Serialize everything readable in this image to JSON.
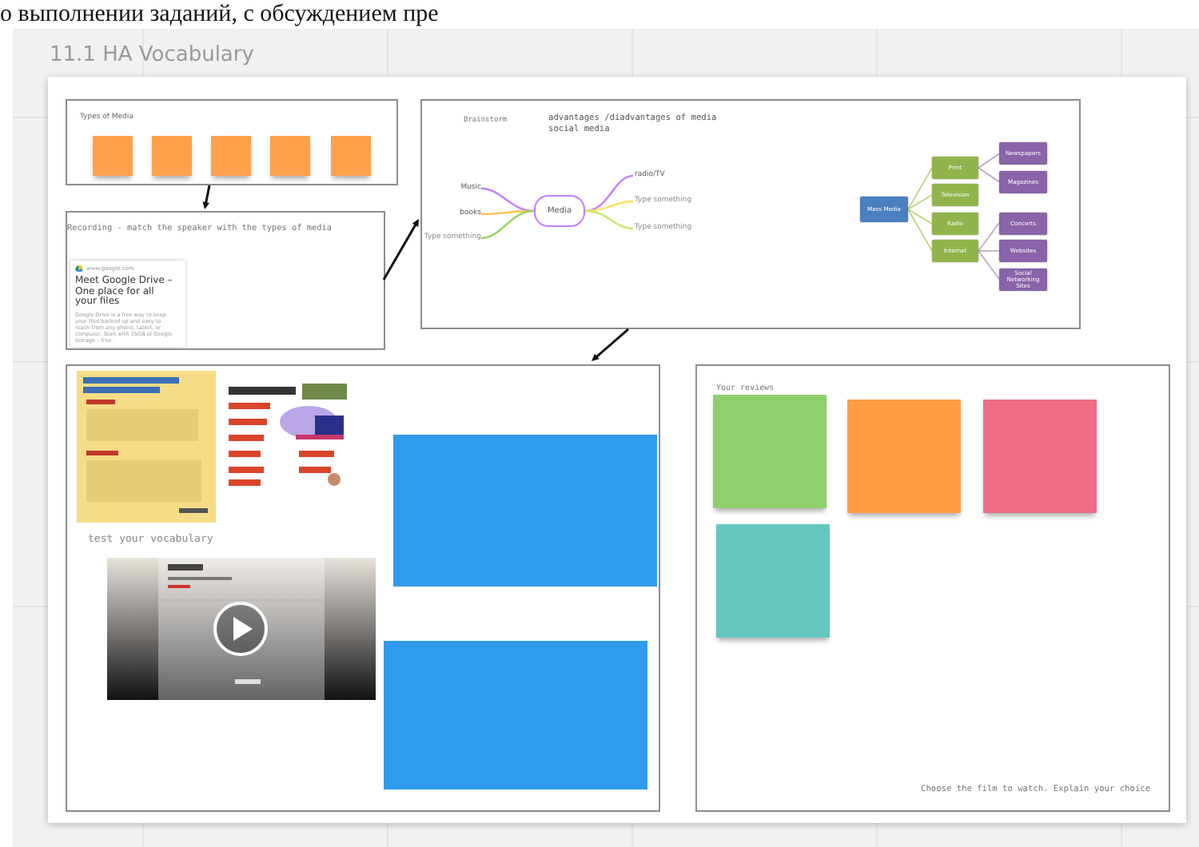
{
  "heading_fragment": "о выполнении заданий, с обсуждением пре",
  "board": {
    "title": "11.1 HA Vocabulary"
  },
  "frames": [
    {
      "kind": "types",
      "label": "Types of Media",
      "stickies": [
        {
          "color": "#ffa04a"
        },
        {
          "color": "#ffa04a"
        },
        {
          "color": "#ffa04a"
        },
        {
          "color": "#ffa04a"
        },
        {
          "color": "#ffa04a"
        }
      ]
    },
    {
      "kind": "recording",
      "label": "Recording - match the speaker with the types of media",
      "link_card": {
        "site": "www.google.com",
        "title": "Meet Google Drive – One place for all your files",
        "description": "Google Drive is a free way to keep your files backed up and easy to reach from any phone, tablet, or computer. Start with 15GB of Google storage – free."
      }
    },
    {
      "kind": "brainstorm",
      "label": "Brainstorm",
      "note": "advantages /diadvantages of media social media",
      "mind_map": {
        "center": "Media",
        "left": [
          {
            "text": "Music",
            "color": "#c77dff"
          },
          {
            "text": "books",
            "color": "#ffc04d"
          },
          {
            "placeholder": "Type something",
            "color": "#8fd45a"
          }
        ],
        "right": [
          {
            "text": "radio/TV",
            "color": "#c77dff"
          },
          {
            "placeholder": "Type something",
            "color": "#ffe066"
          },
          {
            "placeholder": "Type something",
            "color": "#c8e86a"
          }
        ]
      },
      "org_chart": {
        "root": "Mass Media",
        "children": [
          {
            "text": "Print",
            "children": [
              {
                "text": "Newspapers"
              },
              {
                "text": "Magazines"
              }
            ]
          },
          {
            "text": "Television"
          },
          {
            "text": "Radio"
          },
          {
            "text": "Internet",
            "children": [
              {
                "text": "Concerts"
              },
              {
                "text": "Websites"
              },
              {
                "text": "Social Networking Sites"
              }
            ]
          }
        ]
      }
    },
    {
      "kind": "vocabulary",
      "label": "test your vocabulary",
      "pictures": [
        {
          "kind": "picture"
        },
        {
          "kind": "picture"
        },
        {
          "kind": "picture"
        }
      ],
      "blocks": [
        {
          "color": "#2e9bec"
        },
        {
          "color": "#2e9bec"
        }
      ]
    },
    {
      "kind": "reviews",
      "label": "Your reviews",
      "stickies": [
        {
          "color": "#8fd06c"
        },
        {
          "color": "#ff9d45"
        },
        {
          "color": "#ee6c84"
        },
        {
          "color": "#66c6c0"
        }
      ],
      "footer": "Choose the film to watch. Explain your choice"
    }
  ]
}
